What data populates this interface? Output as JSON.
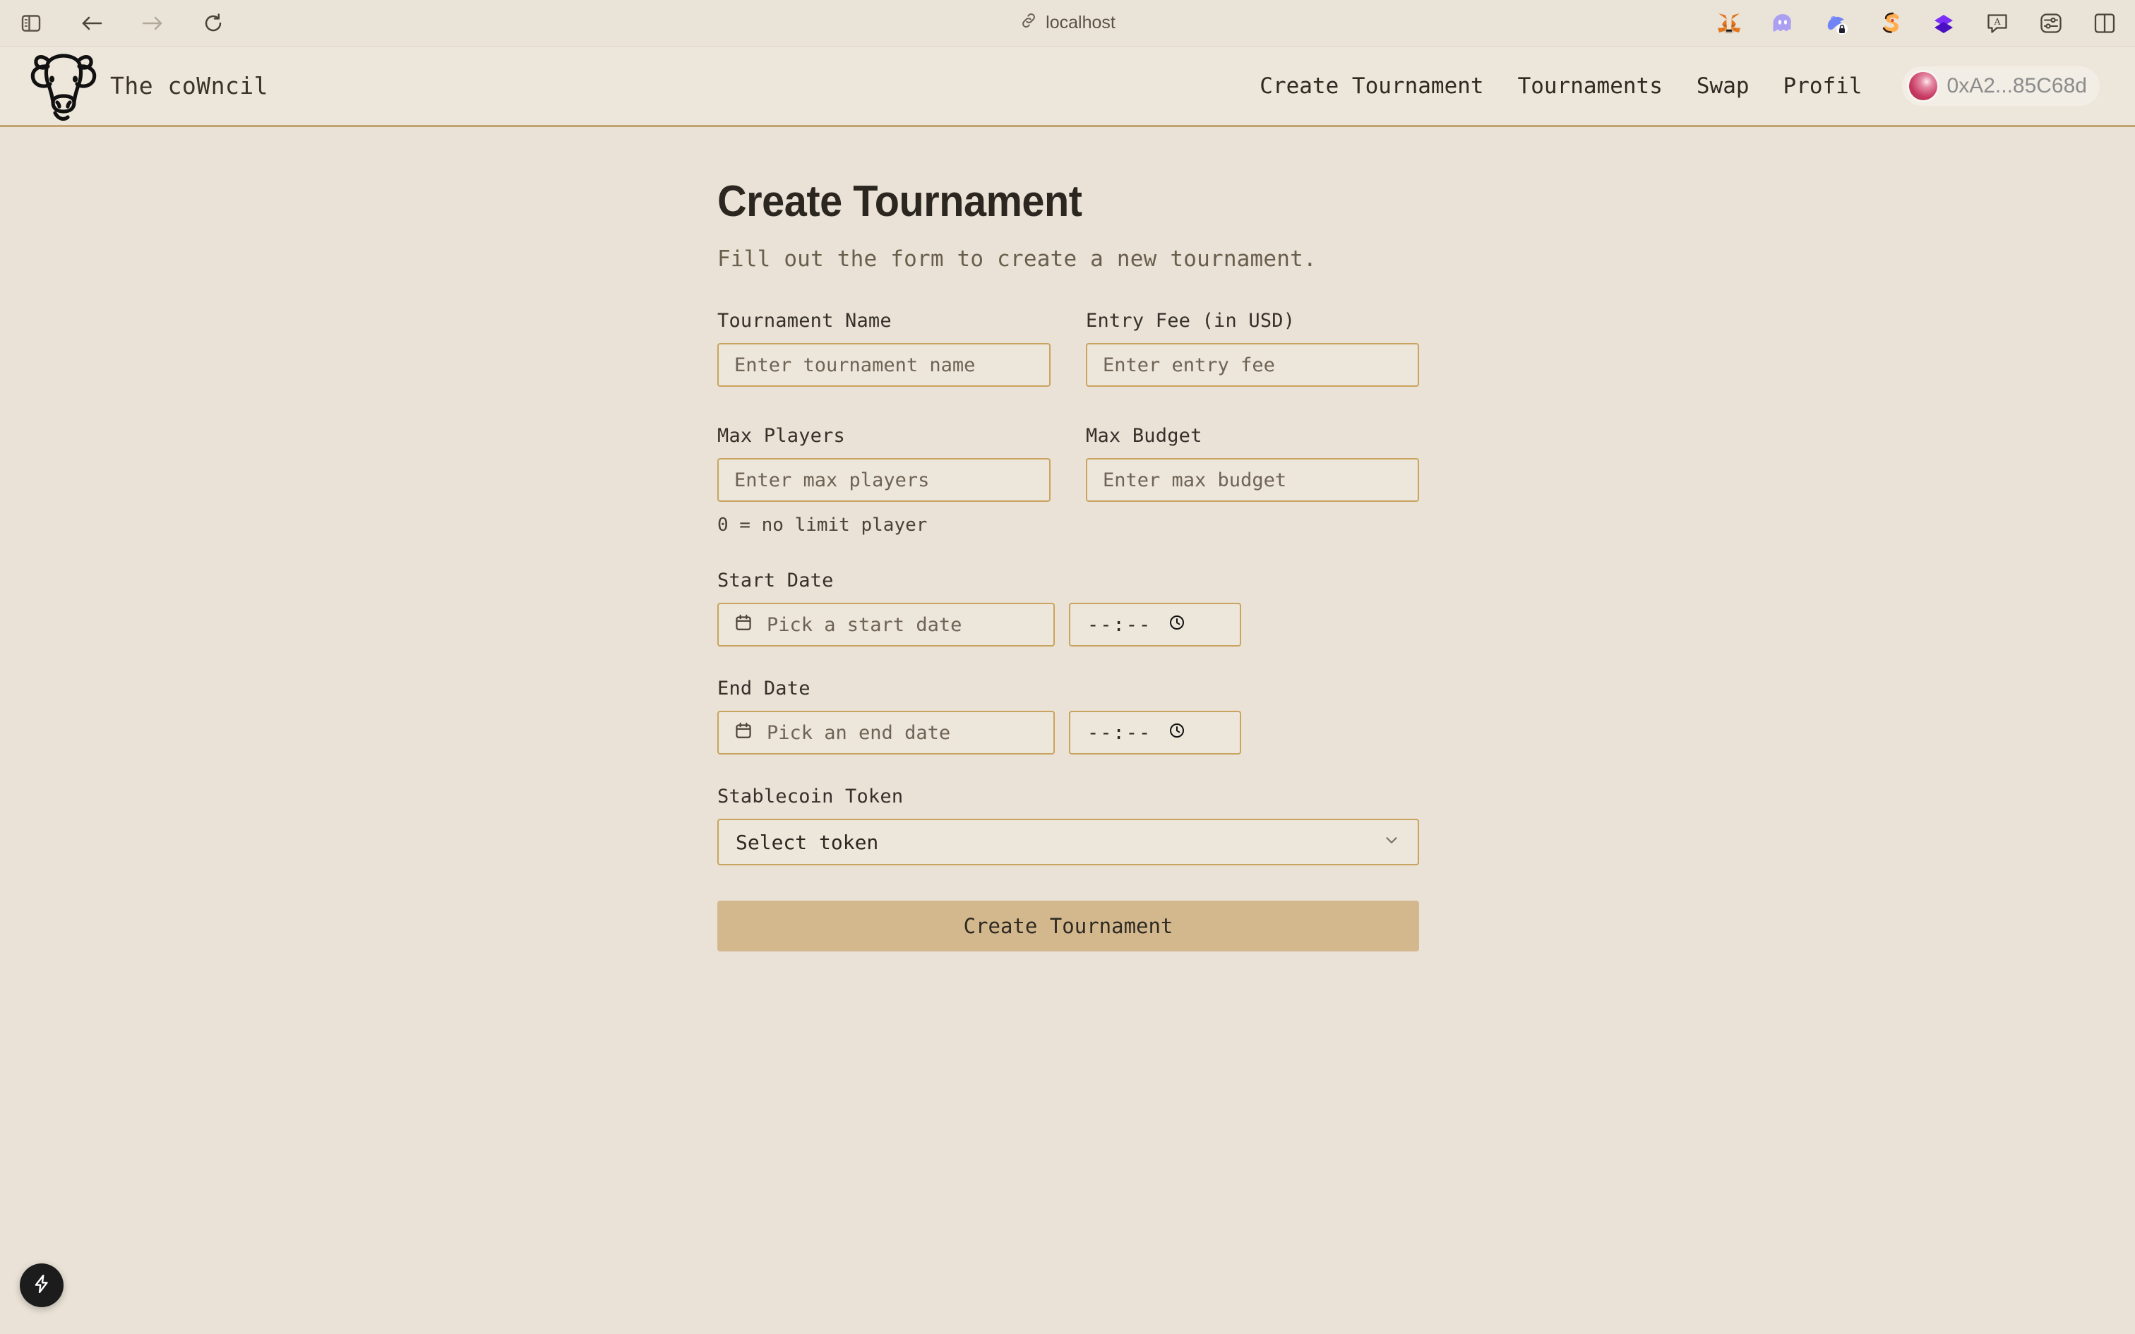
{
  "browser": {
    "sidebar_toggle": "sidebar-toggle",
    "back": "back",
    "forward": "forward",
    "reload": "reload",
    "url": "localhost",
    "extensions": [
      {
        "name": "metamask-extension-icon"
      },
      {
        "name": "phantom-extension-icon"
      },
      {
        "name": "rabby-extension-icon"
      },
      {
        "name": "solflare-extension-icon"
      },
      {
        "name": "backpack-extension-icon"
      },
      {
        "name": "translate-icon"
      },
      {
        "name": "reader-settings-icon"
      },
      {
        "name": "split-view-icon"
      }
    ]
  },
  "header": {
    "brand_name": "The coWncil",
    "nav": [
      {
        "label": "Create Tournament"
      },
      {
        "label": "Tournaments"
      },
      {
        "label": "Swap"
      },
      {
        "label": "Profil"
      }
    ],
    "wallet": {
      "address": "0xA2...85C68d"
    }
  },
  "main": {
    "title": "Create Tournament",
    "subtitle": "Fill out the form to create a new tournament.",
    "fields": {
      "tournament_name": {
        "label": "Tournament Name",
        "placeholder": "Enter tournament name",
        "value": ""
      },
      "entry_fee": {
        "label": "Entry Fee (in USD)",
        "placeholder": "Enter entry fee",
        "value": ""
      },
      "max_players": {
        "label": "Max Players",
        "placeholder": "Enter max players",
        "value": "",
        "helper": "0 = no limit player"
      },
      "max_budget": {
        "label": "Max Budget",
        "placeholder": "Enter max budget",
        "value": ""
      },
      "start_date": {
        "label": "Start Date",
        "date_placeholder": "Pick a start date",
        "time_value": "--:--"
      },
      "end_date": {
        "label": "End Date",
        "date_placeholder": "Pick an end date",
        "time_value": "--:--"
      },
      "stablecoin_token": {
        "label": "Stablecoin Token",
        "selected": "Select token"
      }
    },
    "submit_label": "Create Tournament"
  },
  "dev_badge": {
    "name": "lightning-bolt-icon"
  },
  "colors": {
    "page_background": "#EAE2D6",
    "header_background": "#EDE6DB",
    "header_border": "#C3A470",
    "input_border": "#C9A45F",
    "button_fill": "#D3B88E",
    "text_primary": "#2B2620",
    "text_muted": "#6E6354",
    "wallet_avatar": "#C83B63"
  }
}
